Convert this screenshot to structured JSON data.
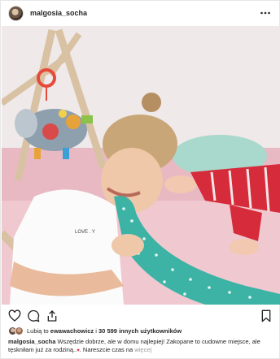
{
  "post": {
    "username": "malgosia_socha",
    "more_icon": "ellipsis-icon",
    "likes": {
      "prefix": "Lubią to",
      "user": "ewawachowicz",
      "middle": "i",
      "count": "30 599",
      "suffix": "innych użytkowników"
    },
    "caption": {
      "user": "malgosia_socha",
      "text_1": "Wszędzie dobrze, ale w domu najlepiej! Zakopane to cudowne miejsce, ale tęskniłam już za rodziną..",
      "emoji": "♥",
      "text_2": ". Nareszcie czas na",
      "more": "więcej"
    },
    "actions": {
      "like_icon": "heart-icon",
      "comment_icon": "comment-icon",
      "share_icon": "share-icon",
      "save_icon": "bookmark-icon"
    }
  },
  "colors": {
    "text": "#262626",
    "muted": "#999999",
    "border": "#e6e6e6",
    "wall": "#ece4e5",
    "pillow": "#a9d8cc",
    "legging": "#3cb3a5",
    "stripes": "#d62b3a"
  }
}
